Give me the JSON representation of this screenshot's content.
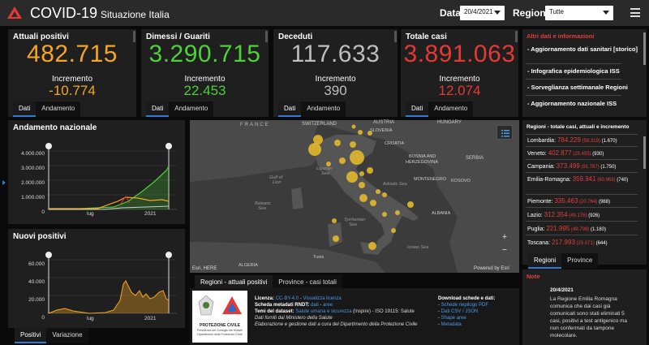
{
  "header": {
    "title": "COVID-19",
    "subtitle": "Situazione Italia",
    "date_label": "Data",
    "date_value": "20/4/2021",
    "region_label": "Regione",
    "region_value": "Tutte"
  },
  "kpis": [
    {
      "title": "Attuali positivi",
      "value": "482.715",
      "inc_label": "Incremento",
      "inc": "-10.774",
      "color": "#f5a623",
      "inc_color": "#f5a623",
      "tabs": [
        "Dati",
        "Andamento"
      ]
    },
    {
      "title": "Dimessi / Guariti",
      "value": "3.290.715",
      "inc_label": "Incremento",
      "inc": "22.453",
      "color": "#4cd137",
      "inc_color": "#4cd137",
      "tabs": [
        "Dati",
        "Andamento"
      ]
    },
    {
      "title": "Deceduti",
      "value": "117.633",
      "inc_label": "Incremento",
      "inc": "390",
      "color": "#bdbdbd",
      "inc_color": "#bdbdbd",
      "tabs": [
        "Dati",
        "Andamento"
      ]
    },
    {
      "title": "Totale casi",
      "value": "3.891.063",
      "inc_label": "Incremento",
      "inc": "12.074",
      "color": "#e53935",
      "inc_color": "#e53935",
      "tabs": [
        "Dati",
        "Andamento"
      ]
    }
  ],
  "info": {
    "title": "Altri dati e informazioni",
    "items": [
      "- Aggiornamento dati sanitari [storico]",
      "- Infografica epidemiologica ISS",
      "- Sorveglianza settimanale Regioni",
      "- Aggiornamento nazionale ISS"
    ]
  },
  "regions": {
    "title": "Regioni - totale casi, attuali e incremento",
    "rows": [
      {
        "name": "Lombardia: ",
        "value": "784.229",
        "stats": " (58.319)",
        "inc": " (1.670)"
      },
      {
        "name": "Veneto: ",
        "value": "402.877",
        "stats": " (25.455)",
        "inc": " (930)"
      },
      {
        "name": "Campania: ",
        "value": "373.499",
        "stats": " (91.787)",
        "inc": " (1.750)"
      },
      {
        "name": "Emilia-Romagna: ",
        "value": "359.941",
        "stats": " (60.963)",
        "inc": " (740)"
      },
      {
        "name": "Piemonte: ",
        "value": "335.463",
        "stats": " (20.764)",
        "inc": " (988)"
      },
      {
        "name": "Lazio: ",
        "value": "312.354",
        "stats": " (49.176)",
        "inc": " (926)"
      },
      {
        "name": "Puglia: ",
        "value": "221.995",
        "stats": " (49.799)",
        "inc": " (1.180)"
      },
      {
        "name": "Toscana: ",
        "value": "217.993",
        "stats": " (25.071)",
        "inc": " (644)"
      }
    ],
    "tabs": [
      "Regioni",
      "Province"
    ]
  },
  "note": {
    "title": "Note",
    "date": "20/4/2021",
    "text": [
      "La Regione Emilia Romagna",
      "comunica che dai casi già",
      "comunicati sono stati eliminati 5",
      "casi, positivi a test antigenico ma",
      "non confermati da tampone",
      "molecolare."
    ]
  },
  "trend": {
    "title": "Andamento nazionale",
    "tabs": [],
    "y_ticks": [
      "4.000.000",
      "3.000.000",
      "2.000.000",
      "1.000.000",
      "0"
    ],
    "x_ticks": [
      "lug",
      "2021"
    ]
  },
  "newpos": {
    "title": "Nuovi positivi",
    "tabs": [
      "Positivi",
      "Variazione"
    ],
    "y_ticks": [
      "60.000",
      "40.000",
      "20.000",
      "0"
    ],
    "x_ticks": [
      "lug",
      "2021"
    ]
  },
  "map": {
    "labels": [
      "FRANCE",
      "SWITZERLAND",
      "AUSTRIA",
      "HUNGARY",
      "SLOVENIA",
      "CROATIA",
      "BOSNIA AND",
      "HERZEGOVINA",
      "SERBIA",
      "MONTENEGRO",
      "KOSOVO",
      "ALBANIA",
      "Ligurian",
      "Sea",
      "Gulf of",
      "Lion",
      "Balearic",
      "Sea",
      "Adriatic Sea",
      "Tyrrhenian",
      "Sea",
      "Ionian Sea",
      "Tunis",
      "ALGERIA"
    ],
    "credit_left": "Esri, HERE",
    "credit_right": "Powered by Esri",
    "tabs": [
      "Regioni - attuali positivi",
      "Province - casi totali"
    ]
  },
  "footer": {
    "logo_text": "PROTEZIONE CIVILE",
    "logo_sub": "Presidenza del Consiglio dei Ministri",
    "logo_sub2": "Dipartimento della Protezione Civile",
    "lic_label": "Licenza:",
    "lic_link": "CC-BY-4.0",
    "lic_sep": " - ",
    "lic_link2": "Visualizza licenza",
    "meta_label": "Scheda metadati RNDT:",
    "meta_link": "dati",
    "meta_sep": " - ",
    "meta_link2": "aree",
    "themes_label": "Temi del dataset:",
    "themes_link": "Salute umana e sicurezza",
    "themes_rest": " (Inspire) - ISO 19115: Salute",
    "line4": "Dati forniti dal Ministero della Salute",
    "line5": "Elaborazione e gestione dati a cura del Dipartimento della Protezione Civile",
    "dl_title": "Download schede e dati:",
    "dl_items": [
      "Schede riepilogo PDF",
      "Dati CSV / JSON",
      "Shape aree",
      "Metadata"
    ]
  }
}
